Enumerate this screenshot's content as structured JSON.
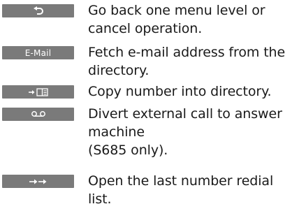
{
  "rows": [
    {
      "key": {
        "icon": "back-arrow-icon",
        "label": ""
      },
      "lines": [
        "Go back one menu level or",
        "cancel operation."
      ]
    },
    {
      "key": {
        "icon": "",
        "label": "E-Mail"
      },
      "lines": [
        "Fetch e-mail address from the",
        "directory."
      ]
    },
    {
      "key": {
        "icon": "copy-to-directory-icon",
        "label": ""
      },
      "lines": [
        "Copy number into directory."
      ]
    },
    {
      "key": {
        "icon": "answer-machine-icon",
        "label": ""
      },
      "lines": [
        "Divert external call to answer",
        "machine",
        "(S685 only)."
      ]
    },
    {
      "key": {
        "icon": "redial-list-icon",
        "label": ""
      },
      "lines": [
        "Open the last number redial",
        "list."
      ]
    }
  ],
  "colors": {
    "key_background": "#7a7a7a",
    "key_foreground": "#ffffff",
    "text": "#1a1a1a"
  }
}
